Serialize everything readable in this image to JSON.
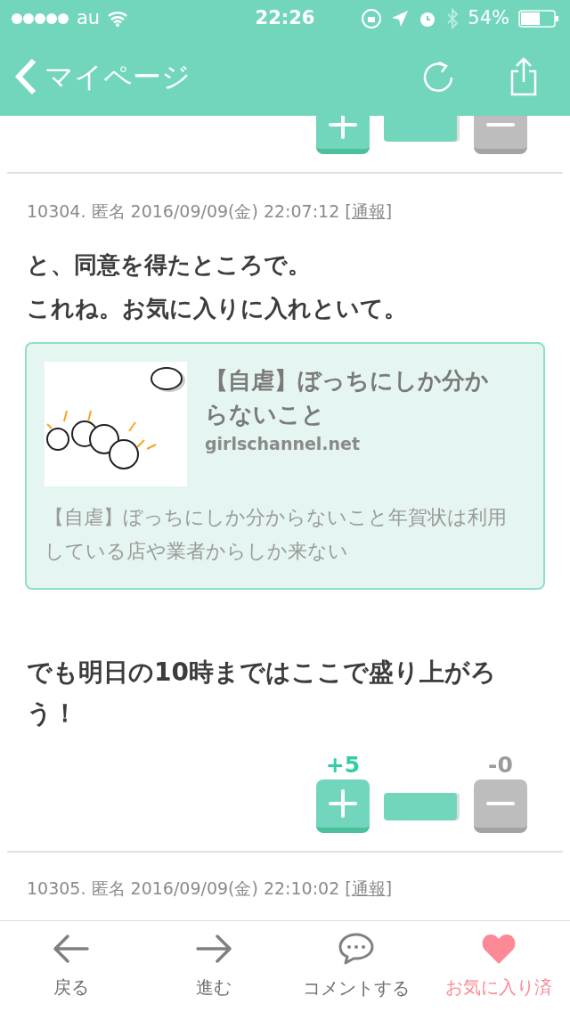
{
  "status_bar": {
    "carrier": "au",
    "time": "22:26",
    "battery": "54%"
  },
  "nav": {
    "back": "マイページ"
  },
  "top_votes": {
    "level": 1
  },
  "comment": {
    "header": "10304. 匿名 2016/09/09(金) 22:07:12 [",
    "report": "通報",
    "header_end": "]",
    "lines": [
      "と、同意を得たところで。",
      "これね。お気に入りに入れといて。"
    ],
    "link_card": {
      "title": "【自虐】ぼっちにしか分からないこと",
      "domain": "girlschannel.net",
      "description": "【自虐】ぼっちにしか分からないこと年賀状は利用している店や業者からしか来ない"
    },
    "text": "でも明日の10時まではここで盛り上がろう！",
    "plus": "+5",
    "minus": "-0",
    "level": 1
  },
  "next_comment": {
    "header": "10305. 匿名 2016/09/09(金) 22:10:02 [",
    "report": "通報",
    "header_end": "]"
  },
  "tab_bar": [
    {
      "label": "戻る",
      "active": false
    },
    {
      "label": "進む",
      "active": false
    },
    {
      "label": "コメントする",
      "active": false
    },
    {
      "label": "お気に入り済",
      "active": true
    }
  ]
}
